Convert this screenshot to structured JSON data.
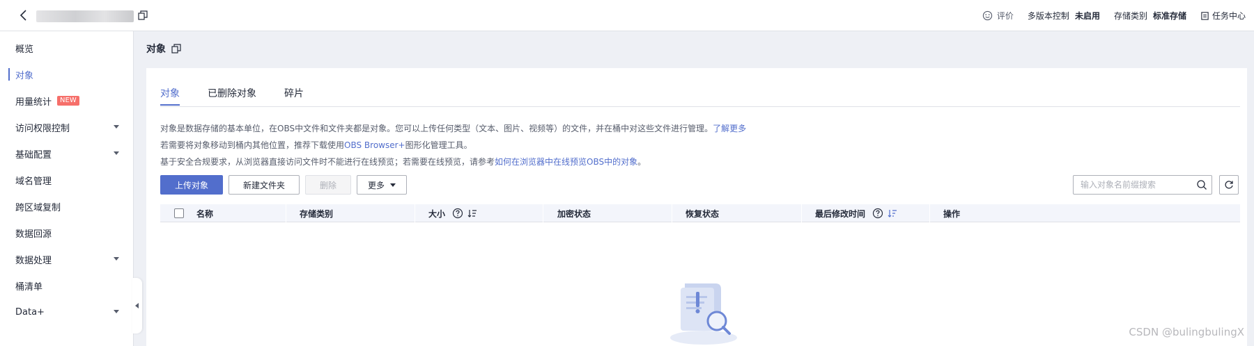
{
  "topbar": {
    "rate_label": "评价",
    "versioning_label": "多版本控制",
    "versioning_value": "未启用",
    "storage_class_label": "存储类别",
    "storage_class_value": "标准存储",
    "task_center_label": "任务中心"
  },
  "sidebar": {
    "items": [
      {
        "label": "概览",
        "active": false,
        "expandable": false
      },
      {
        "label": "对象",
        "active": true,
        "expandable": false
      },
      {
        "label": "用量统计",
        "badge": "NEW",
        "active": false,
        "expandable": false
      },
      {
        "label": "访问权限控制",
        "active": false,
        "expandable": true
      },
      {
        "label": "基础配置",
        "active": false,
        "expandable": true
      },
      {
        "label": "域名管理",
        "active": false,
        "expandable": false
      },
      {
        "label": "跨区域复制",
        "active": false,
        "expandable": false
      },
      {
        "label": "数据回源",
        "active": false,
        "expandable": false
      },
      {
        "label": "数据处理",
        "active": false,
        "expandable": true
      },
      {
        "label": "桶清单",
        "active": false,
        "expandable": false
      },
      {
        "label": "Data+",
        "active": false,
        "expandable": true
      }
    ]
  },
  "page": {
    "title": "对象"
  },
  "tabs": [
    {
      "label": "对象",
      "active": true
    },
    {
      "label": "已删除对象",
      "active": false
    },
    {
      "label": "碎片",
      "active": false
    }
  ],
  "description": {
    "line1_text": "对象是数据存储的基本单位，在OBS中文件和文件夹都是对象。您可以上传任何类型（文本、图片、视频等）的文件，并在桶中对这些文件进行管理。",
    "line1_link": "了解更多",
    "line2_pre": "若需要将对象移动到桶内其他位置，推荐下载使用",
    "line2_link": "OBS Browser+",
    "line2_post": "图形化管理工具。",
    "line3_pre": "基于安全合规要求，从浏览器直接访问文件时不能进行在线预览；若需要在线预览，请参考",
    "line3_link": "如何在浏览器中在线预览OBS中的对象",
    "line3_post": "。"
  },
  "toolbar": {
    "upload_label": "上传对象",
    "new_folder_label": "新建文件夹",
    "delete_label": "删除",
    "more_label": "更多",
    "search_placeholder": "输入对象名前缀搜索"
  },
  "table": {
    "columns": [
      "名称",
      "存储类别",
      "大小",
      "加密状态",
      "恢复状态",
      "最后修改时间",
      "操作"
    ]
  },
  "watermark": "CSDN @bulingbulingX",
  "colors": {
    "accent": "#526ecc",
    "badge": "#f66f6a",
    "text": "#252b3a",
    "background": "#eef0f5"
  }
}
